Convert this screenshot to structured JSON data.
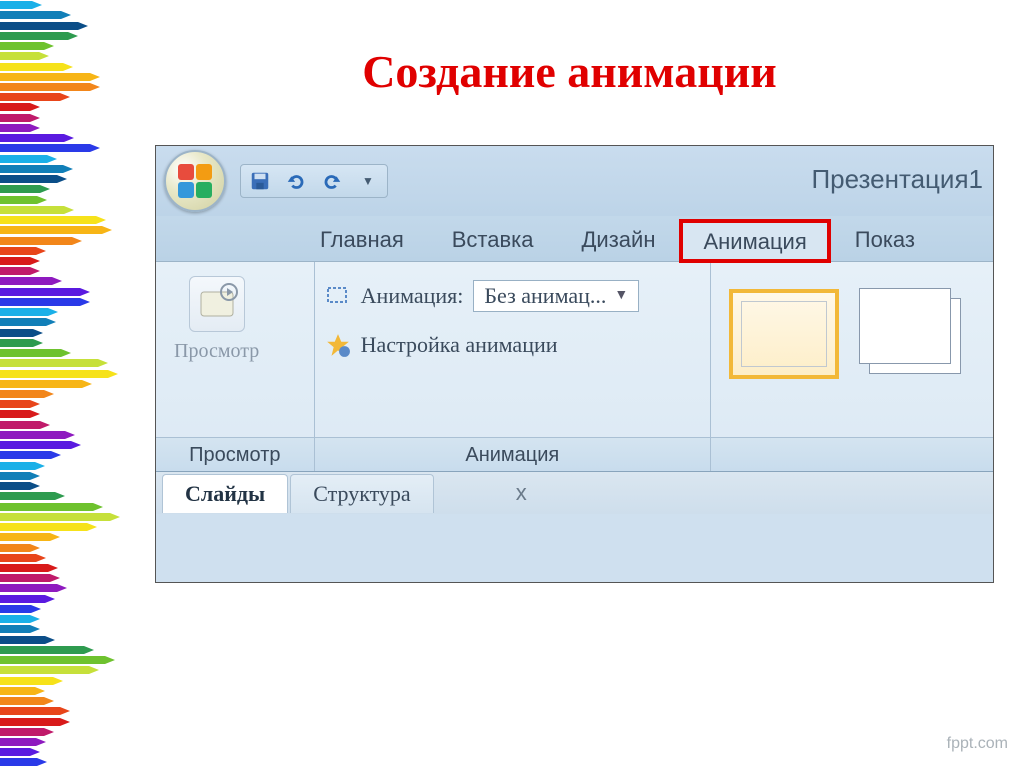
{
  "slide_title": "Создание анимации",
  "titlebar": {
    "doc_name": "Презентация1"
  },
  "tabs": {
    "home": "Главная",
    "insert": "Вставка",
    "design": "Дизайн",
    "animation": "Анимация",
    "show": "Показ"
  },
  "ribbon": {
    "preview_group": {
      "button": "Просмотр",
      "label": "Просмотр"
    },
    "animation_group": {
      "combo_label": "Анимация:",
      "combo_value": "Без анимац...",
      "settings": "Настройка анимации",
      "label": "Анимация"
    }
  },
  "bottom_tabs": {
    "slides": "Слайды",
    "outline": "Структура"
  },
  "footer": "fppt.com",
  "pencil_colors": [
    "#1ab0e8",
    "#117fb8",
    "#0b4e88",
    "#2e9b4f",
    "#6ec22e",
    "#c6e03a",
    "#f6e21a",
    "#f7b516",
    "#f2861a",
    "#e8451a",
    "#d81a1a",
    "#c01a6a",
    "#8e1abf",
    "#5a1ae0",
    "#2a3ae8"
  ]
}
